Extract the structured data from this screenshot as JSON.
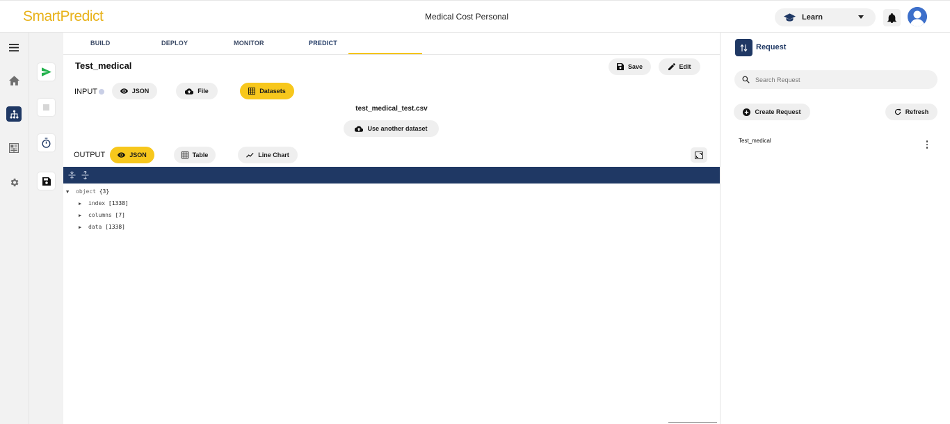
{
  "header": {
    "logo": {
      "text": "SmartPredict"
    },
    "title": "Medical Cost Personal",
    "learn_label": "Learn"
  },
  "tabs": [
    {
      "label": "BUILD"
    },
    {
      "label": "DEPLOY"
    },
    {
      "label": "MONITOR"
    },
    {
      "label": "PREDICT",
      "active": true
    }
  ],
  "request": {
    "name": "Test_medical",
    "save_label": "Save",
    "edit_label": "Edit",
    "input_label": "INPUT",
    "input_modes": [
      "JSON",
      "File",
      "Datasets"
    ],
    "input_selected": "Datasets",
    "dataset_file": "test_medical_test.csv",
    "use_another_label": "Use another dataset",
    "output_label": "OUTPUT",
    "output_modes": [
      "JSON",
      "Table",
      "Line Chart"
    ],
    "output_selected": "JSON"
  },
  "json_tree": {
    "root": "object",
    "root_count": "{3}",
    "children": [
      {
        "key": "index",
        "count": "[1338]"
      },
      {
        "key": "columns",
        "count": "[7]"
      },
      {
        "key": "data",
        "count": "[1338]"
      }
    ]
  },
  "right_panel": {
    "title": "Request",
    "search_placeholder": "Search Request",
    "create_label": "Create Request",
    "refresh_label": "Refresh",
    "items": [
      {
        "name": "Test_medical"
      }
    ]
  },
  "colors": {
    "accent": "#f7c71c",
    "navy": "#1f3864",
    "send_green": "#22b14c"
  }
}
